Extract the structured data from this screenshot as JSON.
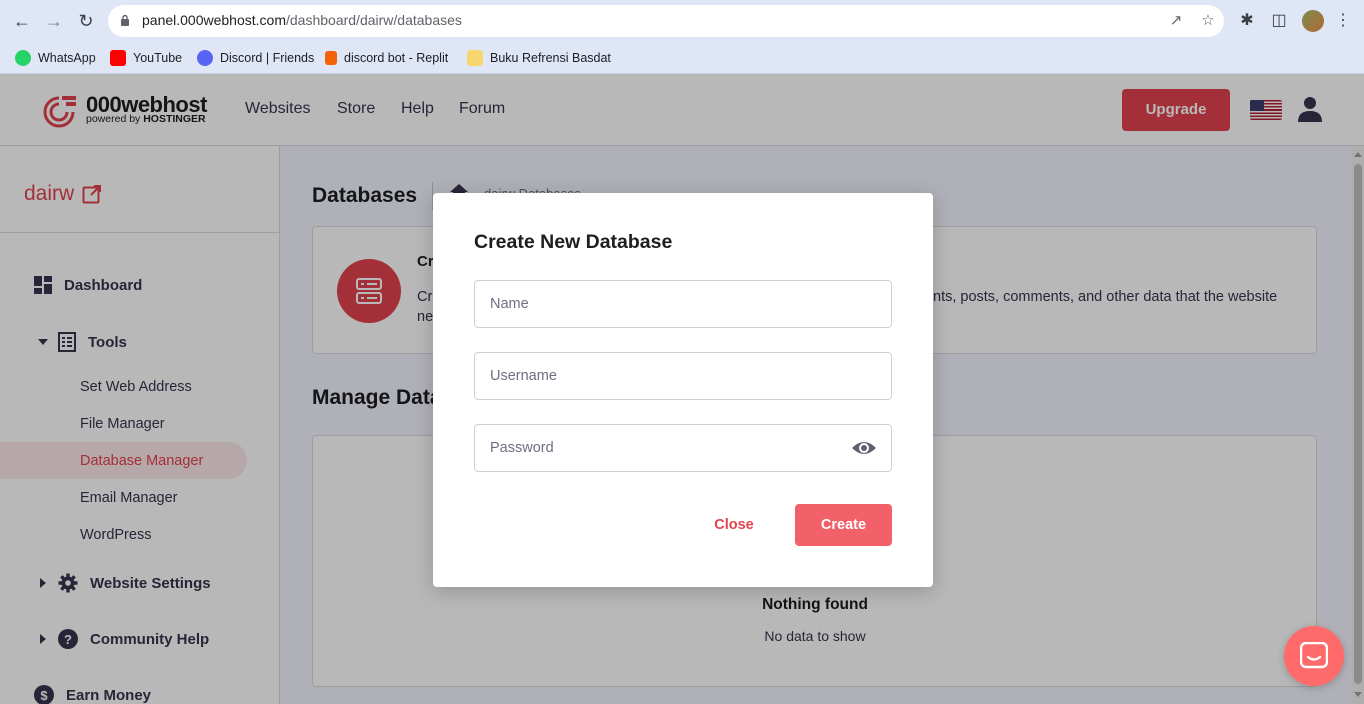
{
  "browser": {
    "url_host": "panel.000webhost.com",
    "url_path": "/dashboard/dairw/databases",
    "bookmarks": [
      {
        "label": "WhatsApp",
        "icon": "whatsapp-icon",
        "color": "#25d366"
      },
      {
        "label": "YouTube",
        "icon": "youtube-icon",
        "color": "#ff0000"
      },
      {
        "label": "Discord | Friends",
        "icon": "discord-icon",
        "color": "#5865f2"
      },
      {
        "label": "discord bot - Replit",
        "icon": "replit-icon",
        "color": "#f26207"
      },
      {
        "label": "Buku Refrensi Basdat",
        "icon": "folder-icon",
        "color": "#f5d76e"
      }
    ]
  },
  "header": {
    "logo_text": "000webhost",
    "logo_sub_prefix": "powered by ",
    "logo_sub_brand": "HOSTINGER",
    "nav": [
      "Websites",
      "Store",
      "Help",
      "Forum"
    ],
    "upgrade_label": "Upgrade",
    "accent": "#e2434e"
  },
  "sidebar": {
    "site_name": "dairw",
    "dashboard": "Dashboard",
    "tools": "Tools",
    "tool_items": [
      "Set Web Address",
      "File Manager",
      "Database Manager",
      "Email Manager",
      "WordPress"
    ],
    "active_item": "Database Manager",
    "website_settings": "Website Settings",
    "community_help": "Community Help",
    "earn_money": "Earn Money"
  },
  "main": {
    "title": "Databases",
    "breadcrumb": "dairw   Databases",
    "card_title": "Cr",
    "card_text_left": "Cr",
    "card_text_right": "nts, posts, comments, and other data that the website",
    "card_text_line2": "ne",
    "manage_title": "Manage Data",
    "nothing_found": "Nothing found",
    "no_data": "No data to show"
  },
  "modal": {
    "title": "Create New Database",
    "name_placeholder": "Name",
    "username_placeholder": "Username",
    "password_placeholder": "Password",
    "close_label": "Close",
    "create_label": "Create"
  }
}
